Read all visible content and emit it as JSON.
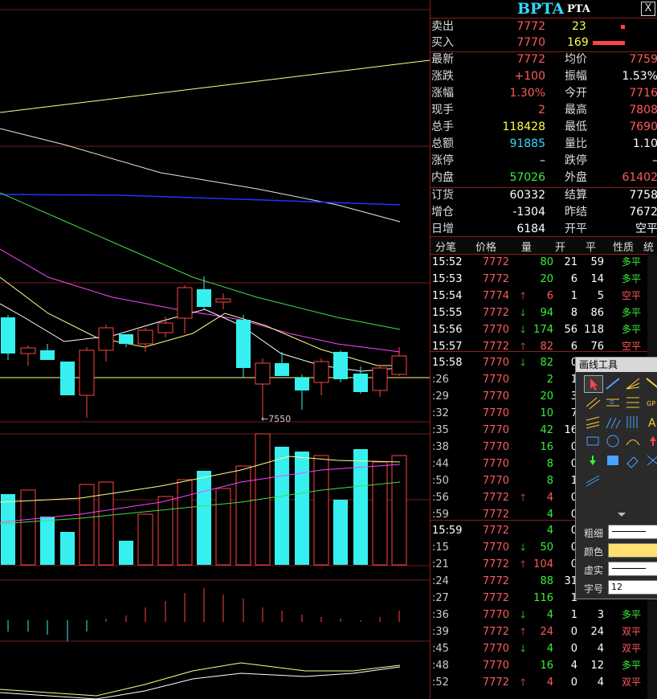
{
  "title": {
    "code": "BPTA",
    "name": "PTA",
    "close": "X"
  },
  "quote": {
    "sell": {
      "label": "卖出",
      "price": "7772",
      "vol": "23"
    },
    "buy": {
      "label": "买入",
      "price": "7770",
      "vol": "169"
    },
    "stats": [
      {
        "l1": "最新",
        "v1": "7772",
        "l2": "均价",
        "v2": "7759"
      },
      {
        "l1": "涨跌",
        "v1": "+100",
        "l2": "振幅",
        "v2": "1.53%"
      },
      {
        "l1": "涨幅",
        "v1": "1.30%",
        "l2": "今开",
        "v2": "7716"
      },
      {
        "l1": "现手",
        "v1": "2",
        "l2": "最高",
        "v2": "7808"
      },
      {
        "l1": "总手",
        "v1": "118428",
        "l2": "最低",
        "v2": "7690"
      },
      {
        "l1": "总额",
        "v1": "91885",
        "l2": "量比",
        "v2": "1.10"
      },
      {
        "l1": "涨停",
        "v1": "–",
        "l2": "跌停",
        "v2": "–"
      },
      {
        "l1": "内盘",
        "v1": "57026",
        "l2": "外盘",
        "v2": "61402"
      }
    ],
    "stats2": [
      {
        "l1": "订货",
        "v1": "60332",
        "l2": "结算",
        "v2": "7758"
      },
      {
        "l1": "增仓",
        "v1": "-1304",
        "l2": "昨结",
        "v2": "7672"
      },
      {
        "l1": "日增",
        "v1": "6184",
        "l2": "开平",
        "v2": "空平"
      }
    ]
  },
  "ticks_header": {
    "time": "分笔",
    "price": "价格",
    "qty": "量",
    "open": "开",
    "close": "平",
    "nature": "性质",
    "extra": "统"
  },
  "ticks": [
    {
      "time": "15:52",
      "price": "7772",
      "arrow": "",
      "qty": "80",
      "open": "21",
      "close": "59",
      "nature": "多平"
    },
    {
      "time": "15:53",
      "price": "7772",
      "arrow": "",
      "qty": "20",
      "open": "6",
      "close": "14",
      "nature": "多平"
    },
    {
      "time": "15:54",
      "price": "7774",
      "arrow": "up",
      "qty": "6",
      "open": "1",
      "close": "5",
      "nature": "空平"
    },
    {
      "time": "15:55",
      "price": "7772",
      "arrow": "down",
      "qty": "94",
      "open": "8",
      "close": "86",
      "nature": "多平"
    },
    {
      "time": "15:56",
      "price": "7770",
      "arrow": "down",
      "qty": "174",
      "open": "56",
      "close": "118",
      "nature": "多平"
    },
    {
      "time": "15:57",
      "price": "7772",
      "arrow": "up",
      "qty": "82",
      "open": "6",
      "close": "76",
      "nature": "空平"
    },
    {
      "time": "15:58",
      "price": "7770",
      "arrow": "down",
      "qty": "82",
      "open": "0",
      "close": "",
      "nature": ""
    },
    {
      "time": ":26",
      "price": "7770",
      "arrow": "",
      "qty": "2",
      "open": "1",
      "close": "",
      "nature": ""
    },
    {
      "time": ":29",
      "price": "7770",
      "arrow": "",
      "qty": "20",
      "open": "3",
      "close": "",
      "nature": ""
    },
    {
      "time": ":32",
      "price": "7770",
      "arrow": "",
      "qty": "10",
      "open": "7",
      "close": "",
      "nature": ""
    },
    {
      "time": ":35",
      "price": "7770",
      "arrow": "",
      "qty": "42",
      "open": "16",
      "close": "",
      "nature": ""
    },
    {
      "time": ":38",
      "price": "7770",
      "arrow": "",
      "qty": "16",
      "open": "0",
      "close": "",
      "nature": ""
    },
    {
      "time": ":44",
      "price": "7770",
      "arrow": "",
      "qty": "8",
      "open": "0",
      "close": "",
      "nature": ""
    },
    {
      "time": ":50",
      "price": "7770",
      "arrow": "",
      "qty": "8",
      "open": "1",
      "close": "",
      "nature": ""
    },
    {
      "time": ":56",
      "price": "7772",
      "arrow": "up",
      "qty": "4",
      "open": "0",
      "close": "",
      "nature": ""
    },
    {
      "time": ":59",
      "price": "7772",
      "arrow": "",
      "qty": "4",
      "open": "0",
      "close": "",
      "nature": ""
    },
    {
      "time": "15:59",
      "price": "7772",
      "arrow": "",
      "qty": "4",
      "open": "0",
      "close": "",
      "nature": ""
    },
    {
      "time": ":15",
      "price": "7770",
      "arrow": "down",
      "qty": "50",
      "open": "0",
      "close": "",
      "nature": ""
    },
    {
      "time": ":21",
      "price": "7772",
      "arrow": "up",
      "qty": "104",
      "open": "0",
      "close": "",
      "nature": ""
    },
    {
      "time": ":24",
      "price": "7772",
      "arrow": "",
      "qty": "88",
      "open": "31",
      "close": "",
      "nature": ""
    },
    {
      "time": ":27",
      "price": "7772",
      "arrow": "",
      "qty": "116",
      "open": "1",
      "close": "",
      "nature": ""
    },
    {
      "time": ":36",
      "price": "7770",
      "arrow": "down",
      "qty": "4",
      "open": "1",
      "close": "3",
      "nature": "多平"
    },
    {
      "time": ":39",
      "price": "7772",
      "arrow": "up",
      "qty": "24",
      "open": "0",
      "close": "24",
      "nature": "双平"
    },
    {
      "time": ":45",
      "price": "7770",
      "arrow": "down",
      "qty": "4",
      "open": "0",
      "close": "4",
      "nature": "双平"
    },
    {
      "time": ":48",
      "price": "7770",
      "arrow": "",
      "qty": "16",
      "open": "4",
      "close": "12",
      "nature": "多平"
    },
    {
      "time": ":52",
      "price": "7772",
      "arrow": "up",
      "qty": "4",
      "open": "0",
      "close": "4",
      "nature": "双平"
    }
  ],
  "toolbox": {
    "title": "画线工具",
    "thickness_label": "粗细",
    "color_label": "颜色",
    "dash_label": "虚实",
    "font_label": "字号",
    "font_size": "12",
    "color_value": "#ffe070"
  },
  "chart": {
    "low_annotation": "←7550",
    "colors": {
      "up": "#ff4444",
      "down": "#36f0f0",
      "ma5": "#ffffff",
      "ma10": "#ffff66",
      "ma20": "#ff44ff",
      "ma40": "#44dd44",
      "ma60": "#2222ff"
    }
  }
}
